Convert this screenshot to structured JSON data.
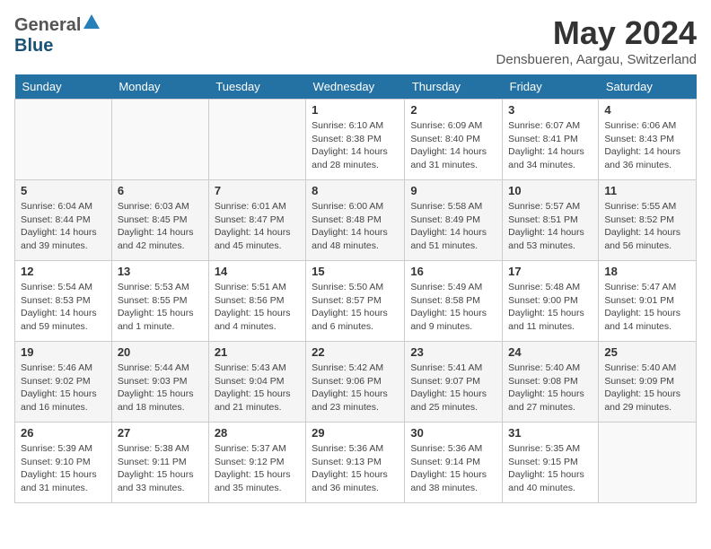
{
  "header": {
    "logo_general": "General",
    "logo_blue": "Blue",
    "month_title": "May 2024",
    "location": "Densbueren, Aargau, Switzerland"
  },
  "weekdays": [
    "Sunday",
    "Monday",
    "Tuesday",
    "Wednesday",
    "Thursday",
    "Friday",
    "Saturday"
  ],
  "weeks": [
    [
      {
        "day": "",
        "info": ""
      },
      {
        "day": "",
        "info": ""
      },
      {
        "day": "",
        "info": ""
      },
      {
        "day": "1",
        "info": "Sunrise: 6:10 AM\nSunset: 8:38 PM\nDaylight: 14 hours\nand 28 minutes."
      },
      {
        "day": "2",
        "info": "Sunrise: 6:09 AM\nSunset: 8:40 PM\nDaylight: 14 hours\nand 31 minutes."
      },
      {
        "day": "3",
        "info": "Sunrise: 6:07 AM\nSunset: 8:41 PM\nDaylight: 14 hours\nand 34 minutes."
      },
      {
        "day": "4",
        "info": "Sunrise: 6:06 AM\nSunset: 8:43 PM\nDaylight: 14 hours\nand 36 minutes."
      }
    ],
    [
      {
        "day": "5",
        "info": "Sunrise: 6:04 AM\nSunset: 8:44 PM\nDaylight: 14 hours\nand 39 minutes."
      },
      {
        "day": "6",
        "info": "Sunrise: 6:03 AM\nSunset: 8:45 PM\nDaylight: 14 hours\nand 42 minutes."
      },
      {
        "day": "7",
        "info": "Sunrise: 6:01 AM\nSunset: 8:47 PM\nDaylight: 14 hours\nand 45 minutes."
      },
      {
        "day": "8",
        "info": "Sunrise: 6:00 AM\nSunset: 8:48 PM\nDaylight: 14 hours\nand 48 minutes."
      },
      {
        "day": "9",
        "info": "Sunrise: 5:58 AM\nSunset: 8:49 PM\nDaylight: 14 hours\nand 51 minutes."
      },
      {
        "day": "10",
        "info": "Sunrise: 5:57 AM\nSunset: 8:51 PM\nDaylight: 14 hours\nand 53 minutes."
      },
      {
        "day": "11",
        "info": "Sunrise: 5:55 AM\nSunset: 8:52 PM\nDaylight: 14 hours\nand 56 minutes."
      }
    ],
    [
      {
        "day": "12",
        "info": "Sunrise: 5:54 AM\nSunset: 8:53 PM\nDaylight: 14 hours\nand 59 minutes."
      },
      {
        "day": "13",
        "info": "Sunrise: 5:53 AM\nSunset: 8:55 PM\nDaylight: 15 hours\nand 1 minute."
      },
      {
        "day": "14",
        "info": "Sunrise: 5:51 AM\nSunset: 8:56 PM\nDaylight: 15 hours\nand 4 minutes."
      },
      {
        "day": "15",
        "info": "Sunrise: 5:50 AM\nSunset: 8:57 PM\nDaylight: 15 hours\nand 6 minutes."
      },
      {
        "day": "16",
        "info": "Sunrise: 5:49 AM\nSunset: 8:58 PM\nDaylight: 15 hours\nand 9 minutes."
      },
      {
        "day": "17",
        "info": "Sunrise: 5:48 AM\nSunset: 9:00 PM\nDaylight: 15 hours\nand 11 minutes."
      },
      {
        "day": "18",
        "info": "Sunrise: 5:47 AM\nSunset: 9:01 PM\nDaylight: 15 hours\nand 14 minutes."
      }
    ],
    [
      {
        "day": "19",
        "info": "Sunrise: 5:46 AM\nSunset: 9:02 PM\nDaylight: 15 hours\nand 16 minutes."
      },
      {
        "day": "20",
        "info": "Sunrise: 5:44 AM\nSunset: 9:03 PM\nDaylight: 15 hours\nand 18 minutes."
      },
      {
        "day": "21",
        "info": "Sunrise: 5:43 AM\nSunset: 9:04 PM\nDaylight: 15 hours\nand 21 minutes."
      },
      {
        "day": "22",
        "info": "Sunrise: 5:42 AM\nSunset: 9:06 PM\nDaylight: 15 hours\nand 23 minutes."
      },
      {
        "day": "23",
        "info": "Sunrise: 5:41 AM\nSunset: 9:07 PM\nDaylight: 15 hours\nand 25 minutes."
      },
      {
        "day": "24",
        "info": "Sunrise: 5:40 AM\nSunset: 9:08 PM\nDaylight: 15 hours\nand 27 minutes."
      },
      {
        "day": "25",
        "info": "Sunrise: 5:40 AM\nSunset: 9:09 PM\nDaylight: 15 hours\nand 29 minutes."
      }
    ],
    [
      {
        "day": "26",
        "info": "Sunrise: 5:39 AM\nSunset: 9:10 PM\nDaylight: 15 hours\nand 31 minutes."
      },
      {
        "day": "27",
        "info": "Sunrise: 5:38 AM\nSunset: 9:11 PM\nDaylight: 15 hours\nand 33 minutes."
      },
      {
        "day": "28",
        "info": "Sunrise: 5:37 AM\nSunset: 9:12 PM\nDaylight: 15 hours\nand 35 minutes."
      },
      {
        "day": "29",
        "info": "Sunrise: 5:36 AM\nSunset: 9:13 PM\nDaylight: 15 hours\nand 36 minutes."
      },
      {
        "day": "30",
        "info": "Sunrise: 5:36 AM\nSunset: 9:14 PM\nDaylight: 15 hours\nand 38 minutes."
      },
      {
        "day": "31",
        "info": "Sunrise: 5:35 AM\nSunset: 9:15 PM\nDaylight: 15 hours\nand 40 minutes."
      },
      {
        "day": "",
        "info": ""
      }
    ]
  ]
}
